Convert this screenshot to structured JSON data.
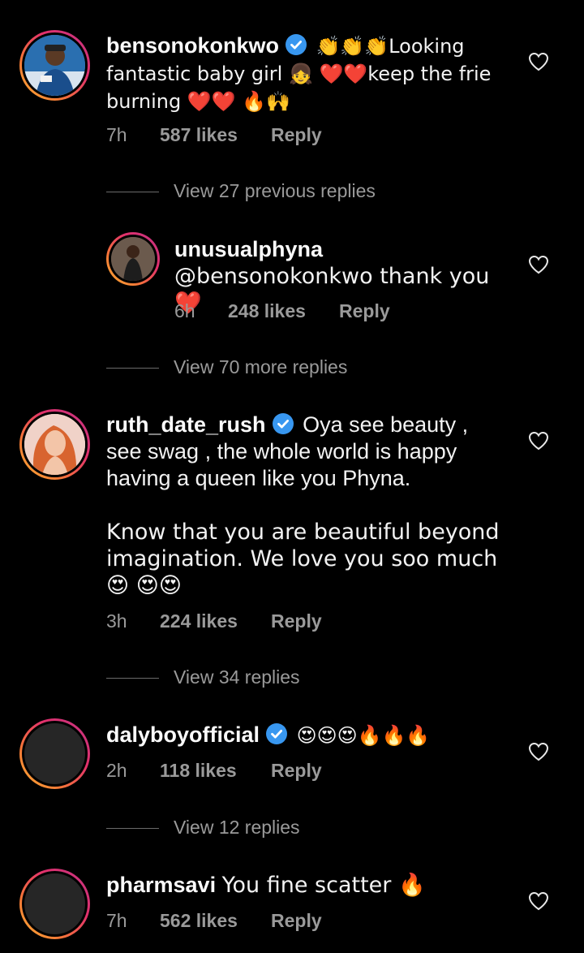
{
  "comments": [
    {
      "username": "bensonokonkwo",
      "verified": true,
      "text": "👏👏👏Looking fantastic baby girl 👧 ❤️❤️keep the frie burning ❤️❤️ 🔥🙌",
      "time": "7h",
      "likes": "587 likes",
      "reply": "Reply",
      "view_replies": "View 27 previous replies",
      "avatar": "man-in-blue-photo"
    },
    {
      "username": "unusualphyna",
      "verified": false,
      "text": "@bensonokonkwo thank you❤️",
      "time": "6h",
      "likes": "248 likes",
      "reply": "Reply",
      "view_replies": "View 70 more replies",
      "avatar": "woman-dark-dress-photo"
    },
    {
      "username": "ruth_date_rush",
      "verified": true,
      "text": "Oya see beauty , see swag , the whole world is happy having a queen like you Phyna.",
      "text2": "Know that you are beautiful beyond imagination. We love you soo much 😍 😍😍",
      "time": "3h",
      "likes": "224 likes",
      "reply": "Reply",
      "view_replies": "View 34 replies",
      "avatar": "woman-red-hair-photo"
    },
    {
      "username": "dalyboyofficial",
      "verified": true,
      "text": "😍😍😍🔥🔥🔥",
      "time": "2h",
      "likes": "118 likes",
      "reply": "Reply",
      "view_replies": "View 12 replies",
      "avatar": "blank-dark-avatar"
    },
    {
      "username": "pharmsavi",
      "verified": false,
      "text": "You fine scatter 🔥",
      "time": "7h",
      "likes": "562 likes",
      "reply": "Reply",
      "avatar": "blank-dark-avatar"
    }
  ],
  "colors": {
    "background": "#000000",
    "text": "#f2f2f2",
    "muted": "#9a9a9a",
    "verified": "#3897f0",
    "story_ring": [
      "#f9b233",
      "#e1306c",
      "#c13584"
    ]
  },
  "icons": {
    "like": "heart-outline-icon",
    "verified": "verified-badge-icon"
  }
}
